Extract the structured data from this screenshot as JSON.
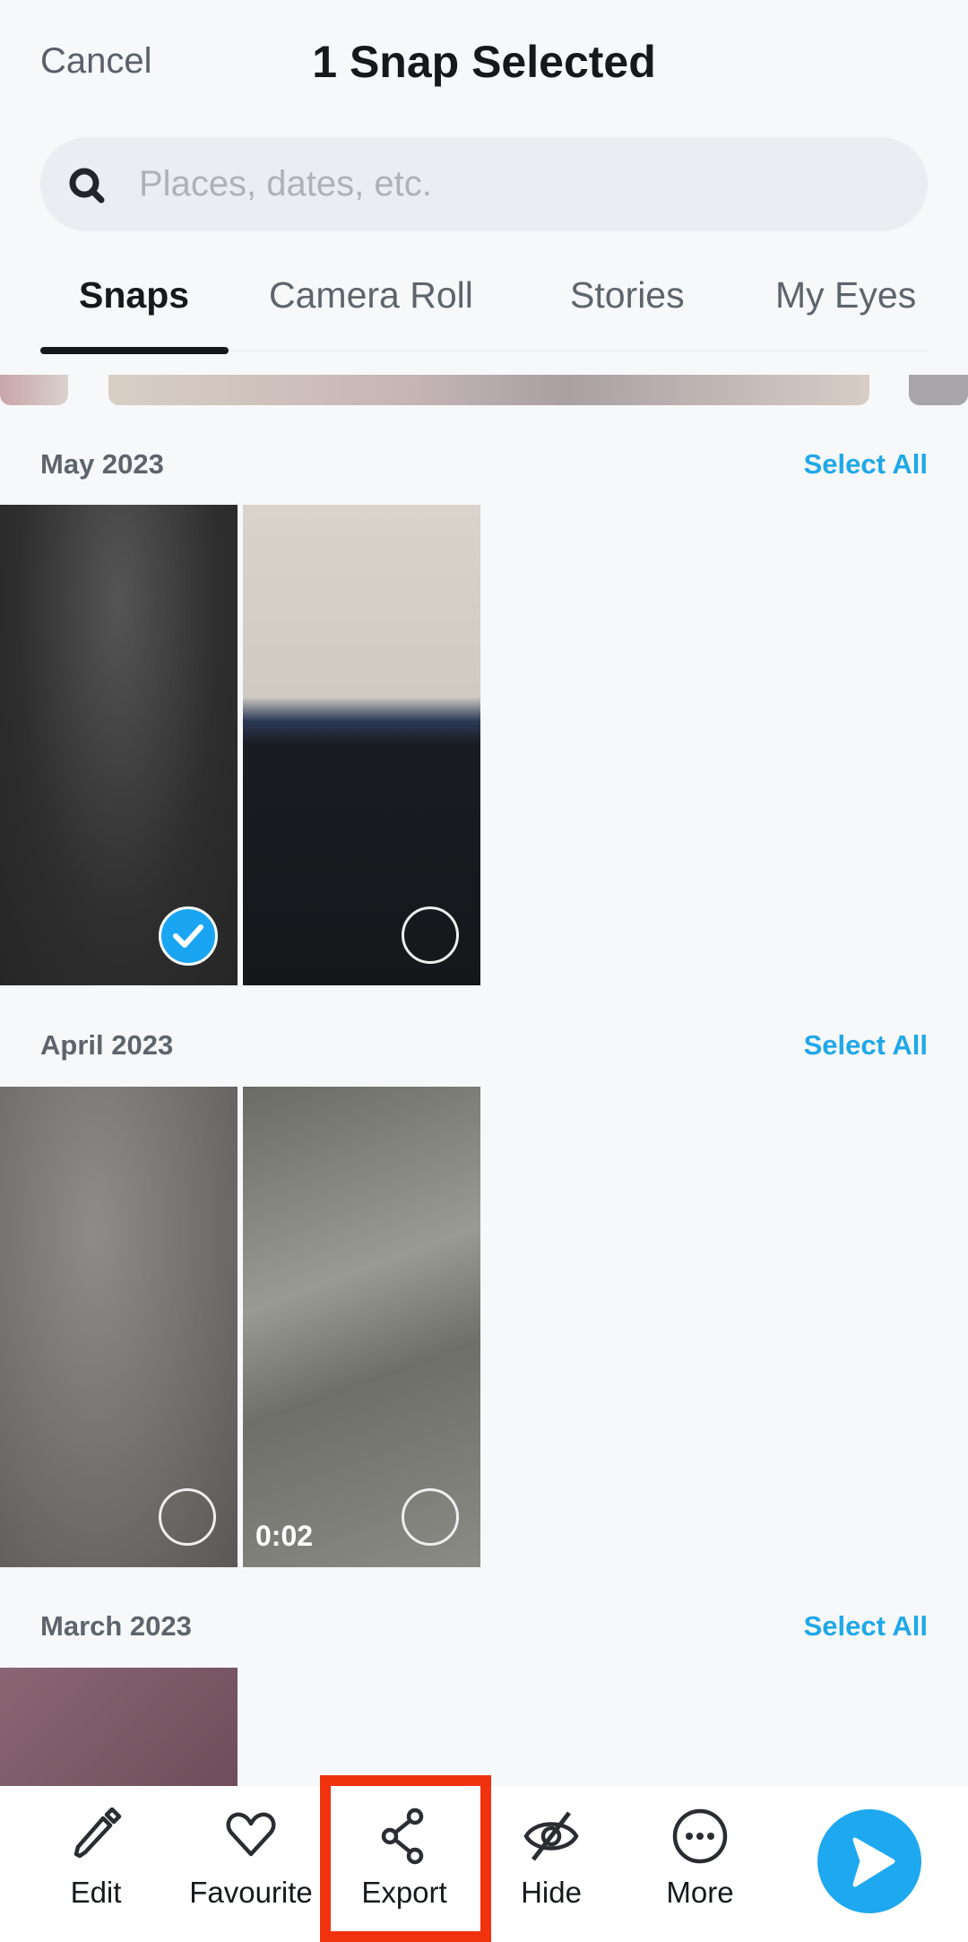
{
  "header": {
    "cancel": "Cancel",
    "title": "1 Snap Selected"
  },
  "search": {
    "placeholder": "Places, dates, etc.",
    "icon": "search-icon"
  },
  "tabs": [
    {
      "label": "Snaps",
      "active": true
    },
    {
      "label": "Camera Roll"
    },
    {
      "label": "Stories"
    },
    {
      "label": "My Eyes"
    }
  ],
  "sections": [
    {
      "title": "May 2023",
      "select_all": "Select All",
      "items": [
        {
          "selected": true
        },
        {
          "selected": false
        }
      ]
    },
    {
      "title": "April 2023",
      "select_all": "Select All",
      "items": [
        {
          "selected": false
        },
        {
          "selected": false,
          "duration": "0:02"
        }
      ]
    },
    {
      "title": "March 2023",
      "select_all": "Select All",
      "items": [
        {
          "selected": false
        }
      ]
    }
  ],
  "actions": [
    {
      "label": "Edit",
      "icon": "pencil-icon"
    },
    {
      "label": "Favourite",
      "icon": "heart-icon"
    },
    {
      "label": "Export",
      "icon": "share-icon",
      "highlighted": true
    },
    {
      "label": "Hide",
      "icon": "eye-off-icon"
    },
    {
      "label": "More",
      "icon": "more-icon"
    }
  ],
  "colors": {
    "accent": "#1ea8f0",
    "highlight": "#f0320f"
  }
}
